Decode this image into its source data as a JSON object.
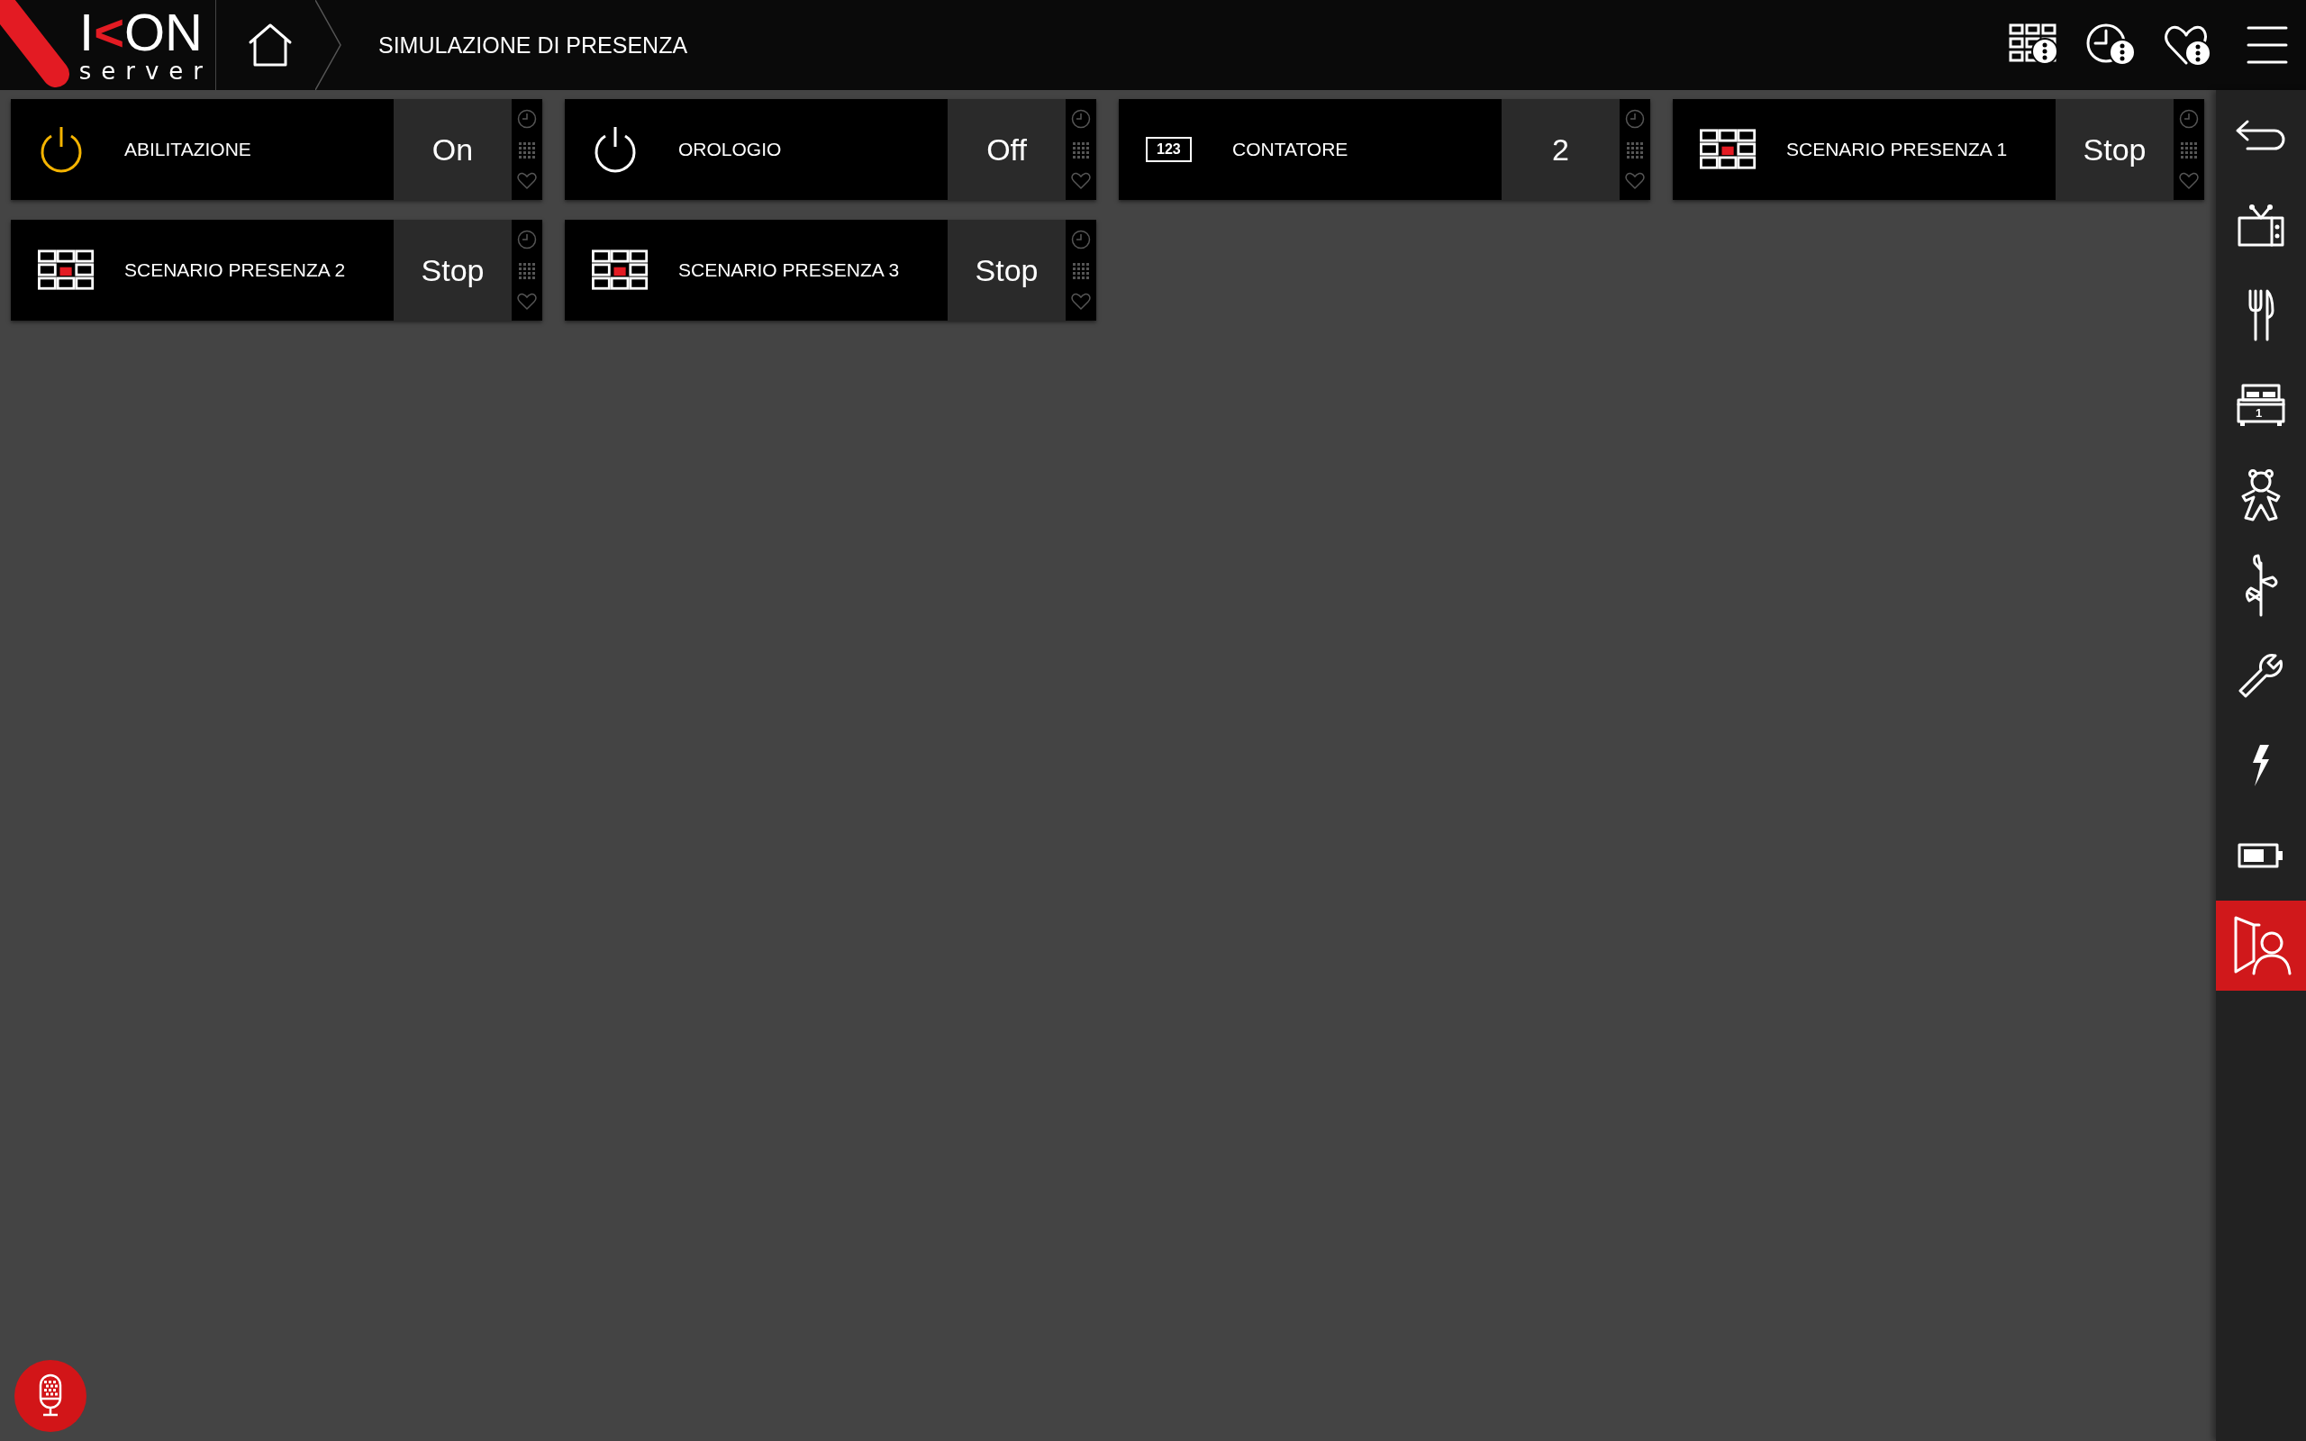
{
  "logo": {
    "mark": "I",
    "accent": "<",
    "rest": "ON",
    "sub": "server"
  },
  "breadcrumb": {
    "title": "SIMULAZIONE DI PRESENZA"
  },
  "header_actions": [
    {
      "kind": "scenarios"
    },
    {
      "kind": "timers"
    },
    {
      "kind": "favorites"
    },
    {
      "kind": "menu"
    }
  ],
  "tiles": [
    {
      "kind": "power",
      "label": "ABILITAZIONE",
      "value": "On",
      "on": true
    },
    {
      "kind": "power",
      "label": "OROLOGIO",
      "value": "Off",
      "on": false
    },
    {
      "kind": "counter",
      "label": "CONTATORE",
      "value": "2",
      "icon_text": "123"
    },
    {
      "kind": "scenario",
      "label": "SCENARIO PRESENZA 1",
      "value": "Stop"
    },
    {
      "kind": "scenario",
      "label": "SCENARIO PRESENZA 2",
      "value": "Stop"
    },
    {
      "kind": "scenario",
      "label": "SCENARIO PRESENZA 3",
      "value": "Stop"
    }
  ],
  "sidebar": {
    "items": [
      {
        "kind": "back",
        "selected": false
      },
      {
        "kind": "tv",
        "selected": false
      },
      {
        "kind": "dining",
        "selected": false
      },
      {
        "kind": "bed",
        "selected": false,
        "badge": "1"
      },
      {
        "kind": "teddy",
        "selected": false
      },
      {
        "kind": "plant",
        "selected": false
      },
      {
        "kind": "wrench",
        "selected": false
      },
      {
        "kind": "bolt",
        "selected": false
      },
      {
        "kind": "battery",
        "selected": false
      },
      {
        "kind": "presence",
        "selected": true
      }
    ]
  },
  "voice_button": {
    "kind": "microphone"
  }
}
